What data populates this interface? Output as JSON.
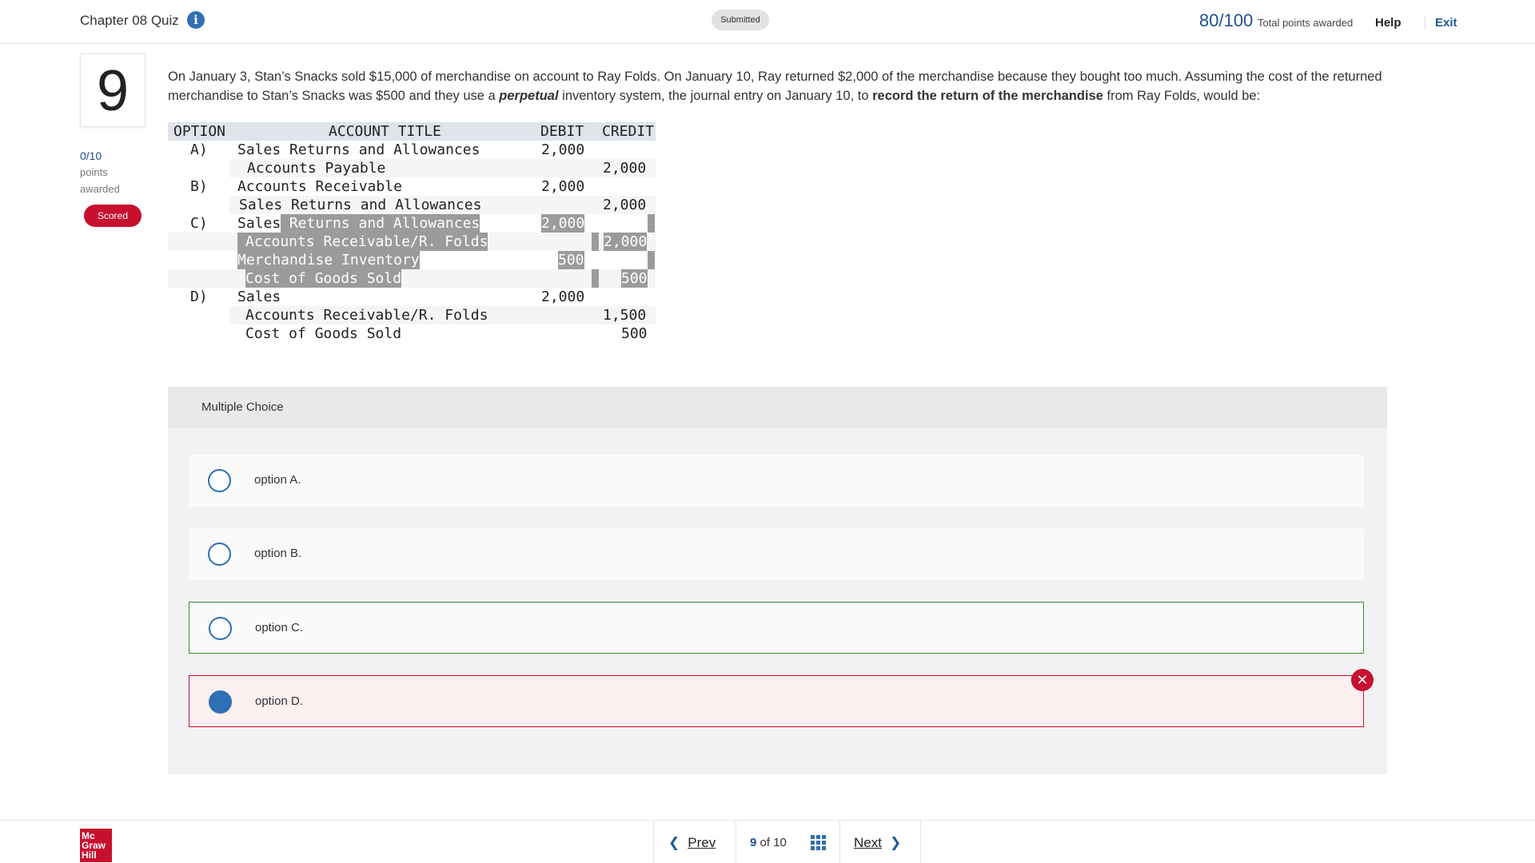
{
  "header": {
    "quiz_title": "Chapter 08 Quiz",
    "info_icon": "info-icon",
    "status_badge": "Submitted",
    "score": "80/100",
    "score_label": "Total points awarded",
    "help_label": "Help",
    "exit_label": "Exit"
  },
  "question": {
    "number": "9",
    "points": "0/10",
    "points_label_line1": "points",
    "points_label_line2": "awarded",
    "scored_badge": "Scored",
    "text_part1": "On January 3, Stan’s Snacks sold $15,000 of merchandise on account to Ray Folds. On January 10, Ray returned $2,000 of the merchandise because they bought too much. Assuming the cost of the returned merchandise to Stan’s Snacks was $500 and they use a ",
    "text_em": "perpetual",
    "text_part2": " inventory system, the journal entry on January 10, to ",
    "text_strong": "record the return of the merchandise",
    "text_part3": " from Ray Folds, would be:"
  },
  "journal_table": {
    "headers": {
      "option": "OPTION",
      "account": "ACCOUNT TITLE",
      "debit": "DEBIT",
      "credit": "CREDIT"
    },
    "rows": [
      {
        "option": "A)",
        "account": "Sales Returns and Allowances",
        "debit": "2,000",
        "credit": ""
      },
      {
        "option": "",
        "account": "Accounts Payable",
        "debit": "",
        "credit": "2,000"
      },
      {
        "option": "B)",
        "account": "Accounts Receivable",
        "debit": "2,000",
        "credit": ""
      },
      {
        "option": "",
        "account": "Sales Returns and Allowances",
        "debit": "",
        "credit": "2,000"
      },
      {
        "option": "C)",
        "account_a": "Sales",
        "account_b": " Returns and Allowances",
        "debit": "2,000",
        "credit": ""
      },
      {
        "option": "",
        "account": "Accounts Receivable/R. Folds",
        "debit": "",
        "credit": "2,000"
      },
      {
        "option": "",
        "account": "Merchandise Inventory",
        "debit": "500",
        "credit": ""
      },
      {
        "option": "",
        "account": "Cost of Goods Sold",
        "debit": "",
        "credit": "500"
      },
      {
        "option": "D)",
        "account": "Sales",
        "debit": "2,000",
        "credit": ""
      },
      {
        "option": "",
        "account": "Accounts Receivable/R. Folds",
        "debit": "",
        "credit": "1,500"
      },
      {
        "option": "",
        "account": "Cost of Goods Sold",
        "debit": "",
        "credit": "500"
      }
    ]
  },
  "multiple_choice": {
    "label": "Multiple Choice",
    "options": [
      {
        "text": "option A.",
        "selected": false,
        "state": "neutral"
      },
      {
        "text": "option B.",
        "selected": false,
        "state": "neutral"
      },
      {
        "text": "option C.",
        "selected": false,
        "state": "correct"
      },
      {
        "text": "option D.",
        "selected": true,
        "state": "incorrect"
      }
    ],
    "incorrect_icon": "close-icon"
  },
  "footer": {
    "logo_lines": [
      "Mc",
      "Graw",
      "Hill"
    ],
    "prev_label": "Prev",
    "current_page": "9",
    "of_label": "of",
    "total_pages": "10",
    "next_label": "Next",
    "grid_icon": "grid-icon"
  },
  "colors": {
    "brand_red": "#c8102e",
    "link_blue": "#1f5a99",
    "score_blue": "#1f4f8f",
    "radio_blue": "#2f6fb3",
    "correct_green": "#3a8a3a"
  }
}
